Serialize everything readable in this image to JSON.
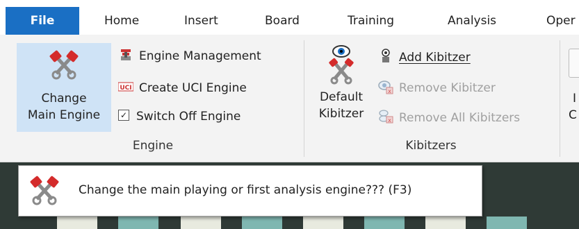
{
  "menu": {
    "items": [
      "File",
      "Home",
      "Insert",
      "Board",
      "Training",
      "Analysis",
      "Oper"
    ]
  },
  "engine_group": {
    "change_main_engine": [
      "Change",
      "Main Engine"
    ],
    "engine_management": "Engine Management",
    "create_uci_engine": "Create UCI Engine",
    "switch_off_engine": "Switch Off Engine",
    "switch_off_checked": "✓",
    "label": "Engine"
  },
  "kibitzers_group": {
    "default_kibitzer": [
      "Default",
      "Kibitzer"
    ],
    "add_kibitzer": "Add Kibitzer",
    "remove_kibitzer": "Remove Kibitzer",
    "remove_all_kibitzers": "Remove All Kibitzers",
    "label": "Kibitzers"
  },
  "next_group": {
    "partial_letters": [
      "I",
      "C"
    ]
  },
  "tooltip": {
    "text": "Change the main playing or first analysis engine??? (F3)"
  },
  "colors": {
    "file_tab": "#1a6fc4",
    "selected_button": "#cfe3f6",
    "board_dark": "#2f3a36",
    "square_light": "#7fb7b1"
  }
}
